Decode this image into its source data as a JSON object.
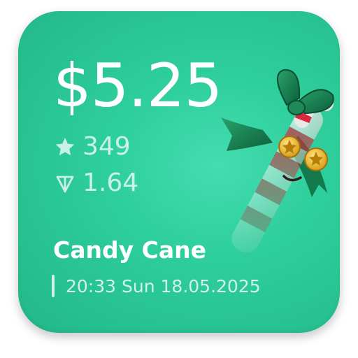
{
  "price": "$5.25",
  "stars": "349",
  "ton": "1.64",
  "name": "Candy Cane",
  "time_date": "20:33 Sun 18.05.2025",
  "icons": {
    "stars": "star-icon",
    "ton": "ton-diamond-icon",
    "illustration": "candy-cane-with-ribbon-illustration"
  },
  "colors": {
    "card_background": "#2ecf9c",
    "text": "#ffffff"
  }
}
